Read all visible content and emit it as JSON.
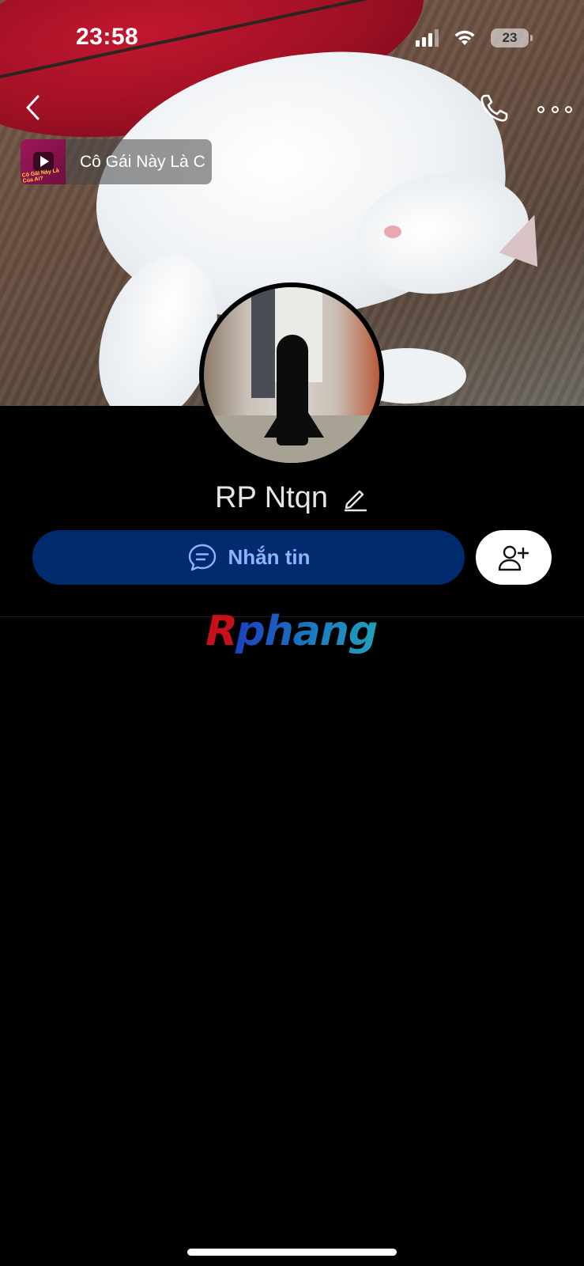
{
  "status_bar": {
    "time": "23:58",
    "battery_level": "23",
    "signal_icon": "signal-bars-icon",
    "wifi_icon": "wifi-icon"
  },
  "nav": {
    "back_icon": "chevron-left-icon",
    "call_icon": "phone-icon",
    "more_icon": "more-dots-icon"
  },
  "music": {
    "title": "Cô Gái Này Là C",
    "thumb_caption": "Cô Gái Này Là Của Ai?",
    "play_icon": "play-icon"
  },
  "profile": {
    "name": "RP Ntqn",
    "edit_icon": "pencil-icon"
  },
  "actions": {
    "message_label": "Nhắn tin",
    "message_icon": "chat-bubble-icon",
    "add_friend_icon": "add-user-icon"
  },
  "watermark": {
    "first": "R",
    "rest": "phang"
  },
  "colors": {
    "background": "#000000",
    "message_button_bg": "#002b6e",
    "message_button_text": "#8eb4ff",
    "add_friend_bg": "#ffffff",
    "name_text": "#e6e6e6"
  }
}
